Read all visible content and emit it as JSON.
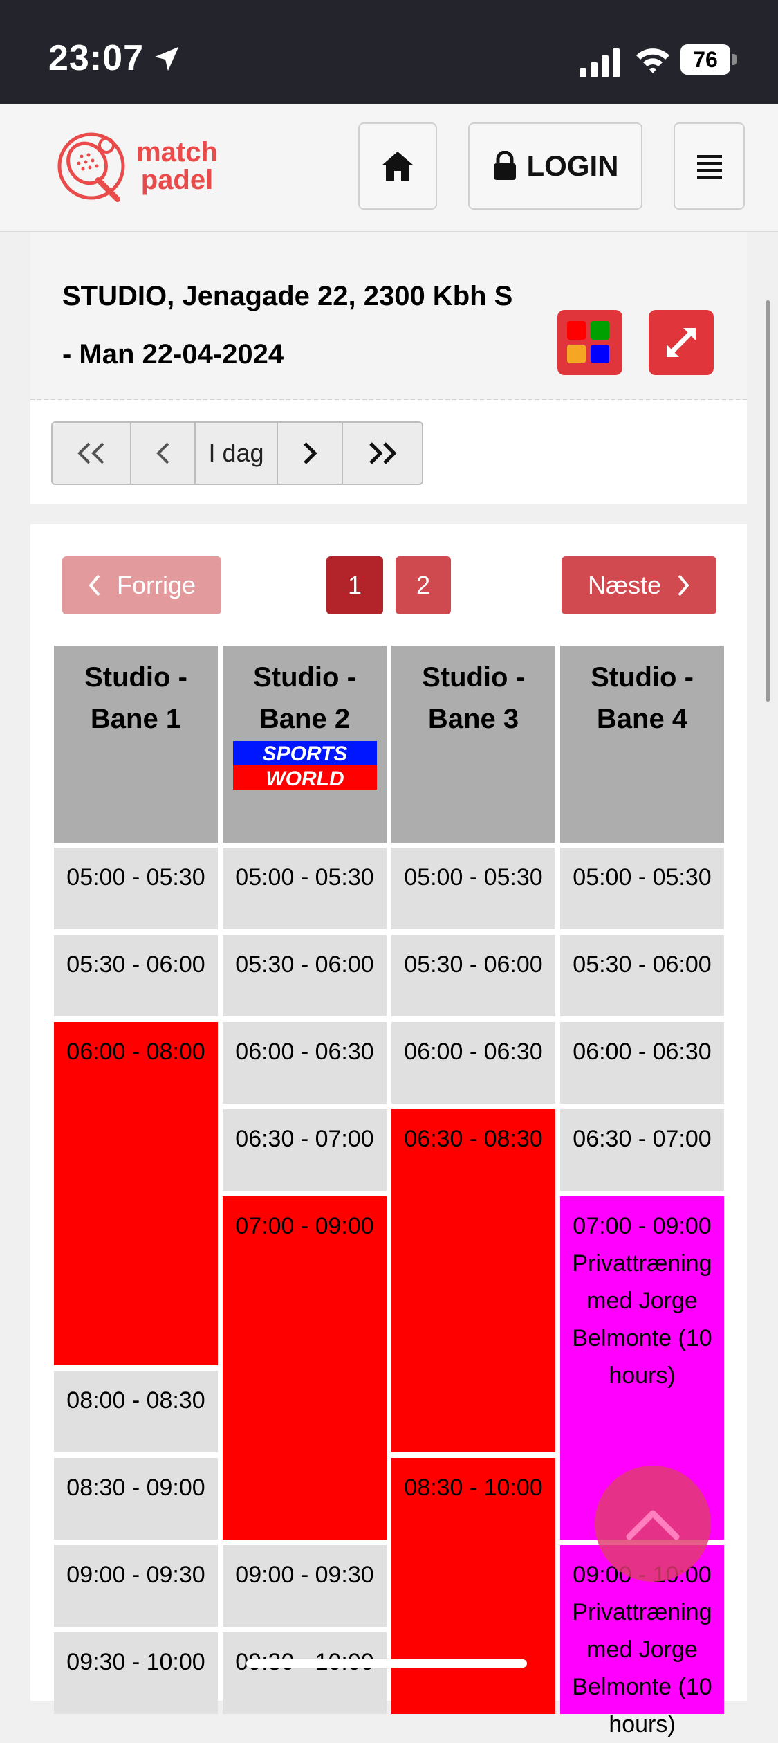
{
  "status_bar": {
    "time": "23:07",
    "battery": "76"
  },
  "header": {
    "logo_line1": "match",
    "logo_line2": "padel",
    "login_label": "LOGIN"
  },
  "venue": {
    "title_line1": "STUDIO, Jenagade 22, 2300 Kbh S",
    "title_line2": "- Man 22-04-2024"
  },
  "date_nav": {
    "today_label": "I dag"
  },
  "pager": {
    "prev_label": "Forrige",
    "next_label": "Næste",
    "pages": [
      "1",
      "2"
    ]
  },
  "courts": [
    {
      "line1": "Studio -",
      "line2": "Bane 1"
    },
    {
      "line1": "Studio -",
      "line2": "Bane 2",
      "sponsor_top": "SPORTS",
      "sponsor_bottom": "WORLD"
    },
    {
      "line1": "Studio -",
      "line2": "Bane 3"
    },
    {
      "line1": "Studio -",
      "line2": "Bane 4"
    }
  ],
  "slots": {
    "c1": [
      "05:00 - 05:30",
      "05:30 - 06:00",
      "06:00 - 08:00",
      "08:00 - 08:30",
      "08:30 - 09:00",
      "09:00 - 09:30",
      "09:30 - 10:00"
    ],
    "c2": [
      "05:00 - 05:30",
      "05:30 - 06:00",
      "06:00 - 06:30",
      "06:30 - 07:00",
      "07:00 - 09:00",
      "09:00 - 09:30",
      "09:30 - 10:00"
    ],
    "c3": [
      "05:00 - 05:30",
      "05:30 - 06:00",
      "06:00 - 06:30",
      "06:30 - 08:30",
      "08:30 - 10:00"
    ],
    "c4": [
      "05:00 - 05:30",
      "05:30 - 06:00",
      "06:00 - 06:30",
      "06:30 - 07:00",
      "07:00 - 09:00",
      "09:00 - 10:00"
    ]
  },
  "private_label": "Privattræning med Jorge Belmonte (10 hours)",
  "colors": {
    "brand": "#e94b4b",
    "booked": "#ff0000",
    "private": "#ff00ff",
    "free": "#e0e0e0",
    "header_col": "#adadad"
  }
}
